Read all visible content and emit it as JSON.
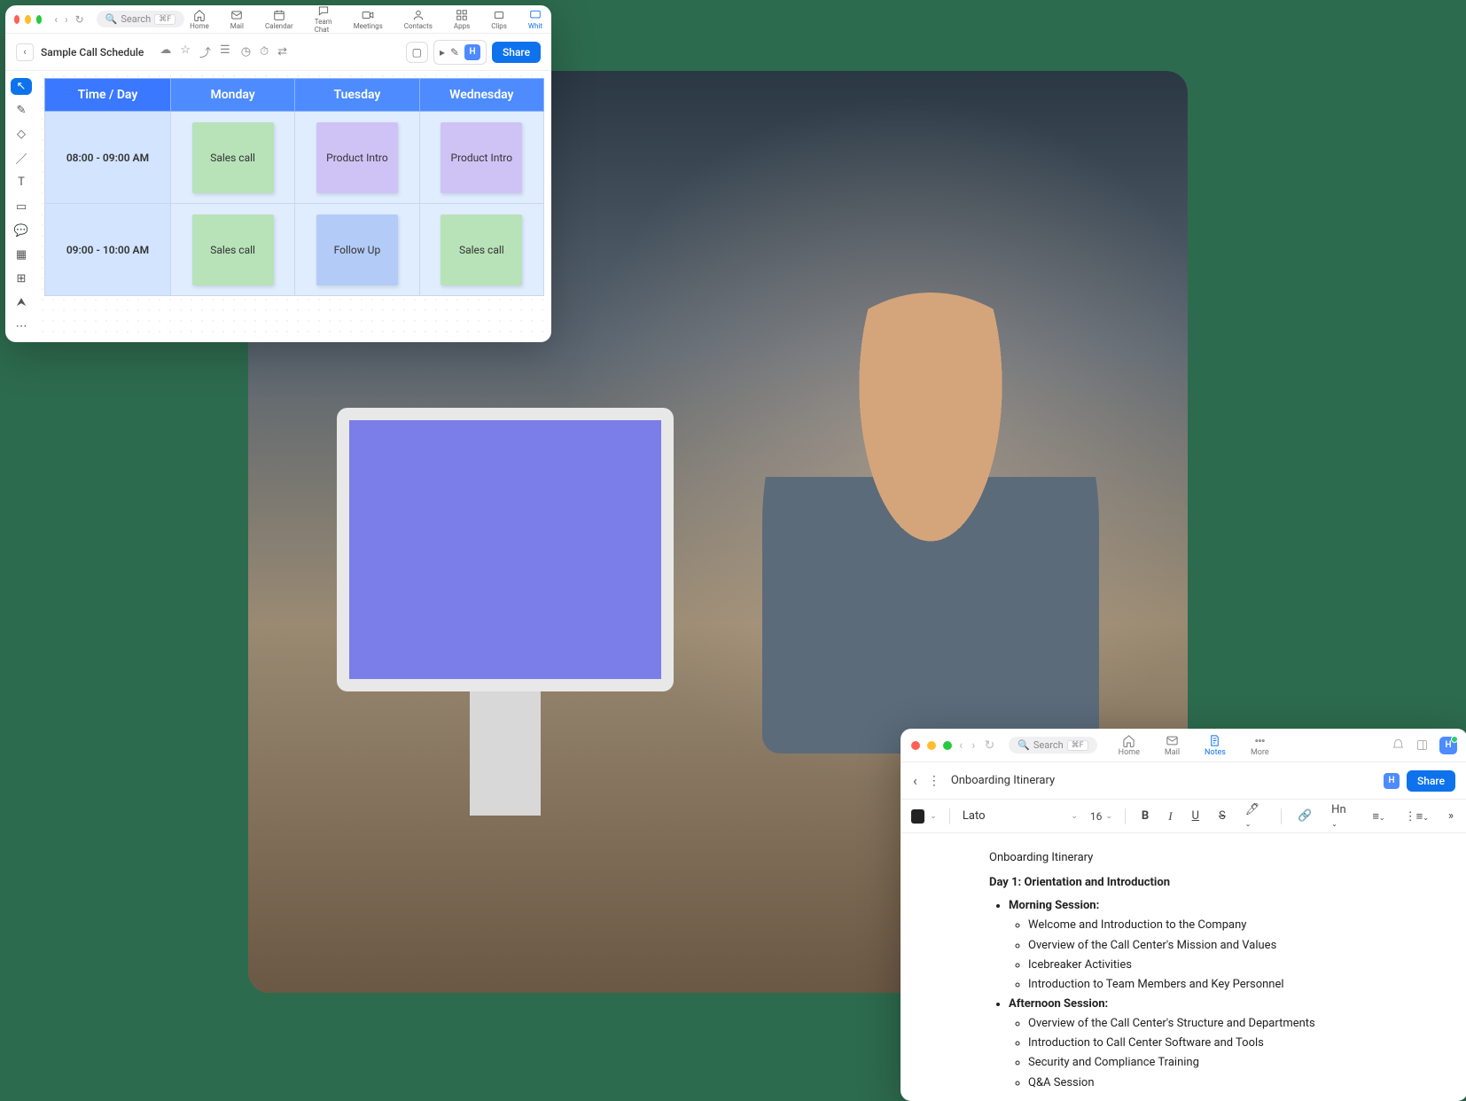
{
  "whiteboard": {
    "search_placeholder": "Search",
    "search_shortcut": "⌘F",
    "nav_apps": [
      "Home",
      "Mail",
      "Calendar",
      "Team Chat",
      "Meetings",
      "Contacts",
      "Apps",
      "Clips",
      "Whit"
    ],
    "doc_title": "Sample Call Schedule",
    "avatar_letter": "H",
    "share_label": "Share",
    "schedule": {
      "header_time": "Time / Day",
      "days": [
        "Monday",
        "Tuesday",
        "Wednesday"
      ],
      "rows": [
        {
          "time": "08:00 - 09:00 AM",
          "cells": [
            {
              "label": "Sales call",
              "color": "green"
            },
            {
              "label": "Product Intro",
              "color": "purple"
            },
            {
              "label": "Product Intro",
              "color": "purple"
            }
          ]
        },
        {
          "time": "09:00 - 10:00 AM",
          "cells": [
            {
              "label": "Sales call",
              "color": "green"
            },
            {
              "label": "Follow Up",
              "color": "blue"
            },
            {
              "label": "Sales call",
              "color": "green"
            }
          ]
        }
      ]
    }
  },
  "notes": {
    "search_placeholder": "Search",
    "search_shortcut": "⌘F",
    "nav_apps": [
      "Home",
      "Mail",
      "Notes",
      "More"
    ],
    "active_app": "Notes",
    "avatar_letter": "H",
    "share_label": "Share",
    "doc_title": "Onboarding Itinerary",
    "font_name": "Lato",
    "font_size": "16",
    "heading_label": "Hn",
    "content": {
      "title": "Onboarding Itinerary",
      "day_heading": "Day 1: Orientation and Introduction",
      "sessions": [
        {
          "label": "Morning Session:",
          "items": [
            "Welcome and Introduction to the Company",
            "Overview of the Call Center's Mission and Values",
            "Icebreaker Activities",
            "Introduction to Team Members and Key Personnel"
          ]
        },
        {
          "label": "Afternoon Session:",
          "items": [
            "Overview of the Call Center's Structure and Departments",
            "Introduction to Call Center Software and Tools",
            "Security and Compliance Training",
            "Q&A Session"
          ]
        }
      ]
    }
  }
}
